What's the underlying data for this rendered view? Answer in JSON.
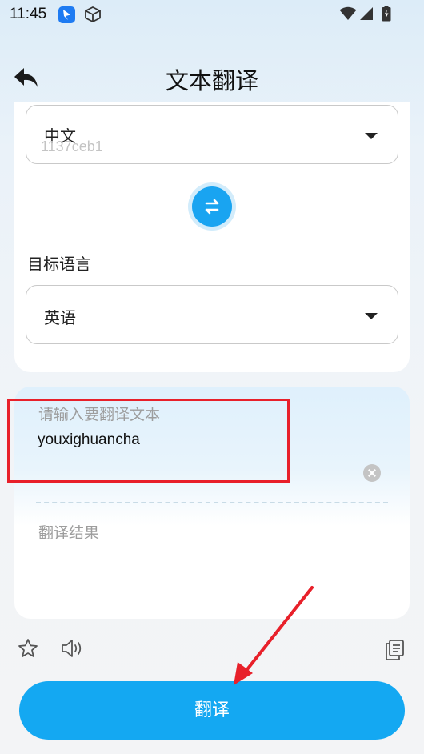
{
  "status_bar": {
    "time": "11:45"
  },
  "header": {
    "title": "文本翻译",
    "back_icon": "back-arrow-icon"
  },
  "language_panel": {
    "source_language": "中文",
    "watermark": "1137ceb1",
    "swap_icon": "swap-arrows-icon",
    "target_label": "目标语言",
    "target_language": "英语"
  },
  "input_panel": {
    "placeholder": "请输入要翻译文本",
    "value": "youxighuancha",
    "result_placeholder": "翻译结果"
  },
  "actions": {
    "favorite_icon": "star-icon",
    "speak_icon": "speaker-icon",
    "copy_icon": "copy-icon",
    "translate_label": "翻译"
  },
  "colors": {
    "accent": "#14a8f2",
    "annotation": "#e8202a"
  }
}
